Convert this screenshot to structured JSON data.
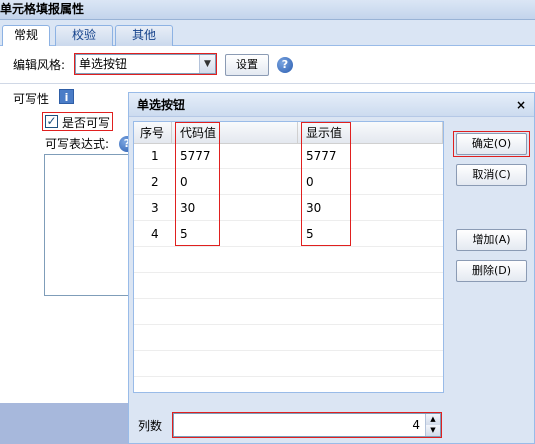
{
  "window": {
    "title": "单元格填报属性"
  },
  "tabs": [
    {
      "label": "常规"
    },
    {
      "label": "校验"
    },
    {
      "label": "其他"
    }
  ],
  "general": {
    "edit_style_label": "编辑风格:",
    "edit_style_value": "单选按钮",
    "settings_button": "设置",
    "writable_label": "可写性",
    "writable_checkbox_label": "是否可写",
    "writable_expr_label": "可写表达式:"
  },
  "dialog": {
    "title": "单选按钮",
    "close_glyph": "×",
    "columns": [
      "序号",
      "代码值",
      "显示值"
    ],
    "rows": [
      {
        "index": "1",
        "code": "5777",
        "display": "5777"
      },
      {
        "index": "2",
        "code": "0",
        "display": "0"
      },
      {
        "index": "3",
        "code": "30",
        "display": "30"
      },
      {
        "index": "4",
        "code": "5",
        "display": "5"
      }
    ],
    "ok_button": "确定(O)",
    "cancel_button": "取消(C)",
    "add_button": "增加(A)",
    "delete_button": "删除(D)",
    "columns_count_label": "列数",
    "columns_count_value": "4"
  },
  "icons": {
    "help": "?",
    "info": "i",
    "checkmark": "✓",
    "dropdown": "▼",
    "spin_up": "▲",
    "spin_down": "▼"
  },
  "colors": {
    "highlight_red": "#e0201f",
    "accent_blue": "#99bbe8"
  }
}
